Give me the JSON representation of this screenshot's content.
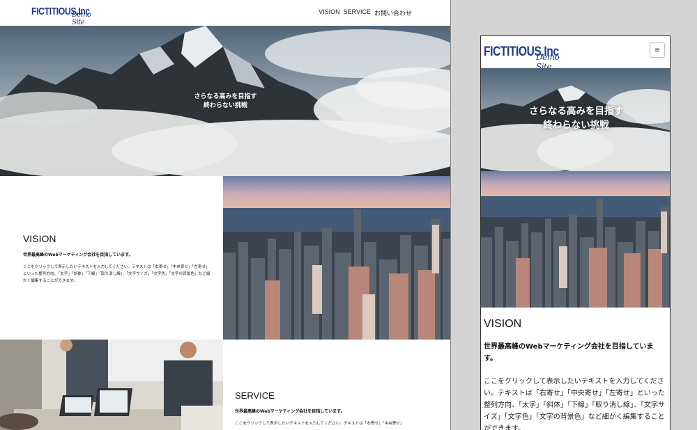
{
  "brand": {
    "name": "FICTITIOUS.Inc",
    "tagline": "Demo Site"
  },
  "nav": {
    "items": [
      "VISION",
      "SERVICE",
      "お問い合わせ"
    ]
  },
  "hero": {
    "line1": "さらなる高みを目指す",
    "line2": "終わらない挑戦"
  },
  "vision": {
    "title": "VISION",
    "subtitle": "世界最高峰のWebマーケティング会社を目指しています。",
    "body_desktop": "ここをクリックして表示したいテキストを入力してください。テキストは「右寄せ」「中央寄せ」「左寄せ」といった整列方向、「太字」「斜体」「下線」「取り消し線」、「文字サイズ」「文字色」「文字の背景色」など細かく編集することができます。",
    "body_mobile": "ここをクリックして表示したいテキストを入力してください。テキストは「右寄せ」「中央寄せ」「左寄せ」といった整列方向、「太字」「斜体」「下線」「取り消し線」、「文字サイズ」「文字色」「文字の背景色」など細かく編集することができます。"
  },
  "service": {
    "title": "SERVICE",
    "subtitle": "世界最高峰のWebマーケティング会社を目指しています。",
    "body": "ここをクリックして表示したいテキストを入力してください。テキストは「右寄せ」「中央寄せ」"
  },
  "menu": {
    "icon": "hamburger-icon",
    "glyph": "≡"
  },
  "colors": {
    "brand": "#1d3b8c",
    "text": "#111111",
    "frame_bg": "#d4d4d4"
  }
}
